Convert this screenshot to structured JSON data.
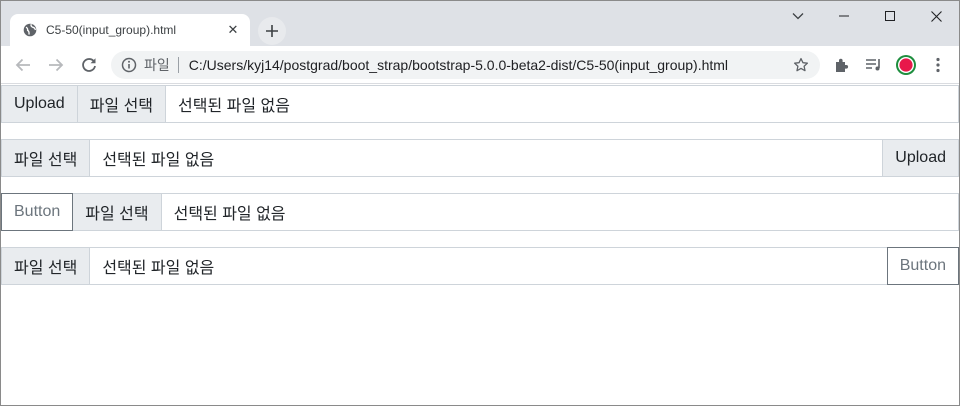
{
  "browser": {
    "tab_title": "C5-50(input_group).html",
    "tab_close": "✕",
    "new_tab": "+",
    "omnibox": {
      "chip": "파일",
      "url": "C:/Users/kyj14/postgrad/boot_strap/bootstrap-5.0.0-beta2-dist/C5-50(input_group).html"
    },
    "profile_color": "#e8184a",
    "profile_ring": "#1e8e3e"
  },
  "groups": [
    {
      "prepend": "Upload",
      "file_button": "파일 선택",
      "file_status": "선택된 파일 없음"
    },
    {
      "file_button": "파일 선택",
      "file_status": "선택된 파일 없음",
      "append": "Upload"
    },
    {
      "button": "Button",
      "file_button": "파일 선택",
      "file_status": "선택된 파일 없음"
    },
    {
      "file_button": "파일 선택",
      "file_status": "선택된 파일 없음",
      "button": "Button"
    }
  ]
}
